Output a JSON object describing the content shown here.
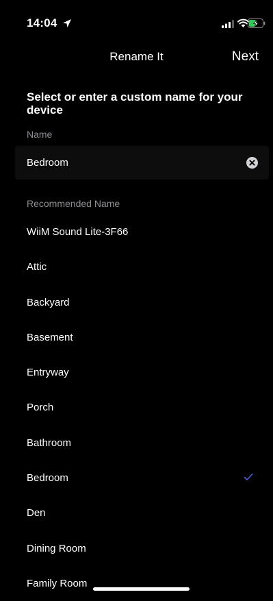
{
  "status_bar": {
    "time": "14:04",
    "icons": [
      "location-arrow-icon",
      "cellular-signal-icon",
      "wifi-icon",
      "battery-charging-icon"
    ]
  },
  "nav": {
    "title": "Rename It",
    "next_label": "Next"
  },
  "headline": "Select or enter a custom name for your device",
  "name_section": {
    "label": "Name",
    "value": "Bedroom"
  },
  "recommended": {
    "label": "Recommended Name",
    "items": [
      {
        "label": "WiiM Sound Lite-3F66",
        "selected": false
      },
      {
        "label": "Attic",
        "selected": false
      },
      {
        "label": "Backyard",
        "selected": false
      },
      {
        "label": "Basement",
        "selected": false
      },
      {
        "label": "Entryway",
        "selected": false
      },
      {
        "label": "Porch",
        "selected": false
      },
      {
        "label": "Bathroom",
        "selected": false
      },
      {
        "label": "Bedroom",
        "selected": true
      },
      {
        "label": "Den",
        "selected": false
      },
      {
        "label": "Dining Room",
        "selected": false
      },
      {
        "label": "Family Room",
        "selected": false
      }
    ]
  },
  "colors": {
    "background": "#000000",
    "text": "#ffffff",
    "secondary_text": "#8e8e93",
    "checkmark": "#4a5fd8",
    "battery_charging": "#34c759"
  }
}
